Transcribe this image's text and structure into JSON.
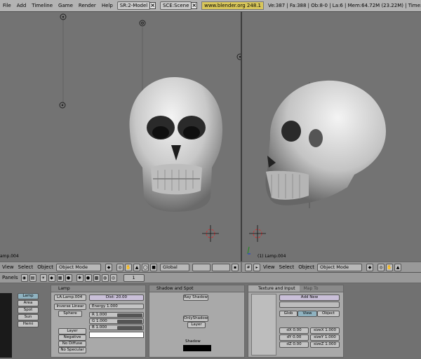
{
  "topbar": {
    "menu": [
      "File",
      "Add",
      "Timeline",
      "Game",
      "Render",
      "Help"
    ],
    "screen_field": "SR:2-Model",
    "scene_field": "SCE:Scene",
    "url": "www.blender.org 248.1",
    "stats": "Ve:387 | Fa:388 | Ob:8-0 | La:6 | Mem:64.72M (23.22M) | Time:00:0"
  },
  "viewports": {
    "left_label": "amp.004",
    "right_label": "(1) Lamp.004"
  },
  "header_left": {
    "menus": [
      "View",
      "Select",
      "Object"
    ],
    "mode": "Object Mode",
    "orientation": "Global"
  },
  "header_right": {
    "menus": [
      "View",
      "Select",
      "Object"
    ],
    "mode": "Object Mode"
  },
  "button_bar": {
    "panels_label": "Panels",
    "frame": "1"
  },
  "lamp_types": [
    "Lamp",
    "Area",
    "Spot",
    "Sun",
    "Hemi"
  ],
  "lamp_panel": {
    "title": "Lamp",
    "name": "LA:Lamp.004",
    "dist": "Dist: 20.00",
    "falloff": "Inverse Linear",
    "sphere": "Sphere",
    "energy": "Energy 1.000",
    "r": "R 1.000",
    "g": "G 1.000",
    "b": "B 1.000",
    "layer": "Layer",
    "negative": "Negative",
    "no_diffuse": "No Diffuse",
    "no_specular": "No Specular"
  },
  "shadow_panel": {
    "title": "Shadow and Spot",
    "ray_shadow": "Ray Shadow",
    "only_shadow": "OnlyShadow",
    "layer": "Layer",
    "shadow_label": "Shadow"
  },
  "texture_panel": {
    "tab_active": "Texture and Input",
    "tab_other": "Map To",
    "add_new": "Add New",
    "glob": "Glob",
    "view": "View",
    "object": "Object",
    "dx": "dX 0.00",
    "dy": "dY 0.00",
    "dz": "dZ 0.00",
    "sizex": "sizeX 1.000",
    "sizey": "sizeY 1.000",
    "sizez": "sizeZ 1.000"
  }
}
